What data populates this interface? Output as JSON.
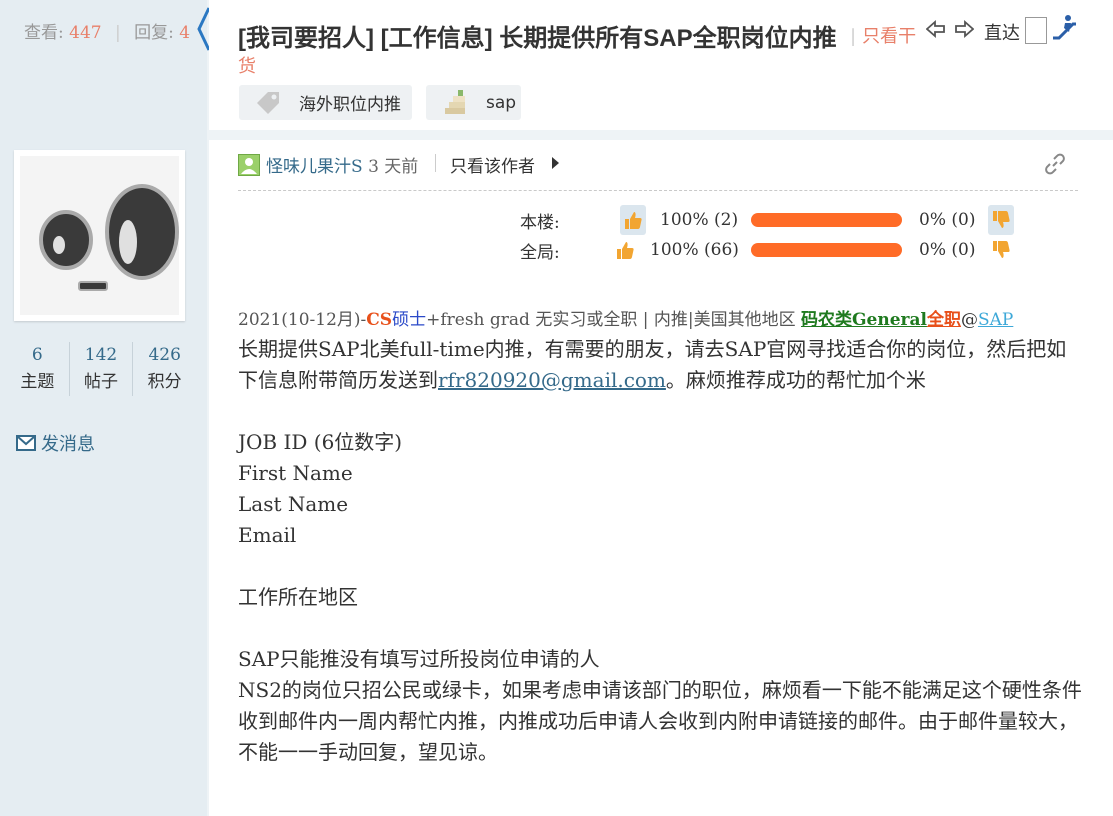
{
  "sidebar": {
    "views_label": "查看:",
    "views": "447",
    "replies_label": "回复:",
    "replies": "4",
    "user_stats": [
      {
        "value": "6",
        "label": "主题"
      },
      {
        "value": "142",
        "label": "帖子"
      },
      {
        "value": "426",
        "label": "积分"
      }
    ],
    "send_message": "发消息"
  },
  "thread": {
    "title": "[我司要招人] [工作信息] 长期提供所有SAP全职岗位内推",
    "only_dry_line1": "只看干",
    "only_dry_line2": "货",
    "goto_label": "直达",
    "tags": [
      "海外职位内推",
      "sap"
    ]
  },
  "post": {
    "author": "怪味儿果汁S",
    "time": "3 天前",
    "only_author": "只看该作者",
    "votes": [
      {
        "label": "本楼:",
        "up": "100% (2)",
        "down": "0% (0)",
        "up_ratio": 1.0
      },
      {
        "label": "全局:",
        "up": "100% (66)",
        "down": "0% (0)",
        "up_ratio": 1.0
      }
    ],
    "tagline": {
      "prefix": "2021(10-12月)-",
      "cs": "CS",
      "degree": "硕士",
      "rest": "+fresh grad 无实习或全职 | 内推|美国其他地区 ",
      "category": "码农类General",
      "fulltime": "全职",
      "at": "@",
      "company": "SAP"
    },
    "intro_before_email": "长期提供SAP北美full-time内推，有需要的朋友，请去SAP官网寻找适合你的岗位，然后把如下信息附带简历发送到",
    "email": "rfr820920@gmail.com",
    "intro_after_email": "。麻烦推荐成功的帮忙加个米",
    "fields": [
      "JOB ID (6位数字)",
      "First Name",
      "Last Name",
      "Email"
    ],
    "location": "工作所在地区",
    "note1": "SAP只能推没有填写过所投岗位申请的人",
    "note2": "NS2的岗位只招公民或绿卡，如果考虑申请该部门的职位，麻烦看一下能不能满足这个硬性条件",
    "note3": "收到邮件内一周内帮忙内推，内推成功后申请人会收到内附申请链接的邮件。由于邮件量较大，不能一一手动回复，望见谅。"
  },
  "colors": {
    "accent_orange": "#e8806a",
    "link_blue": "#356a8a",
    "vote_bar": "#ff6b27",
    "sidebar_bg": "#e5edf2"
  }
}
